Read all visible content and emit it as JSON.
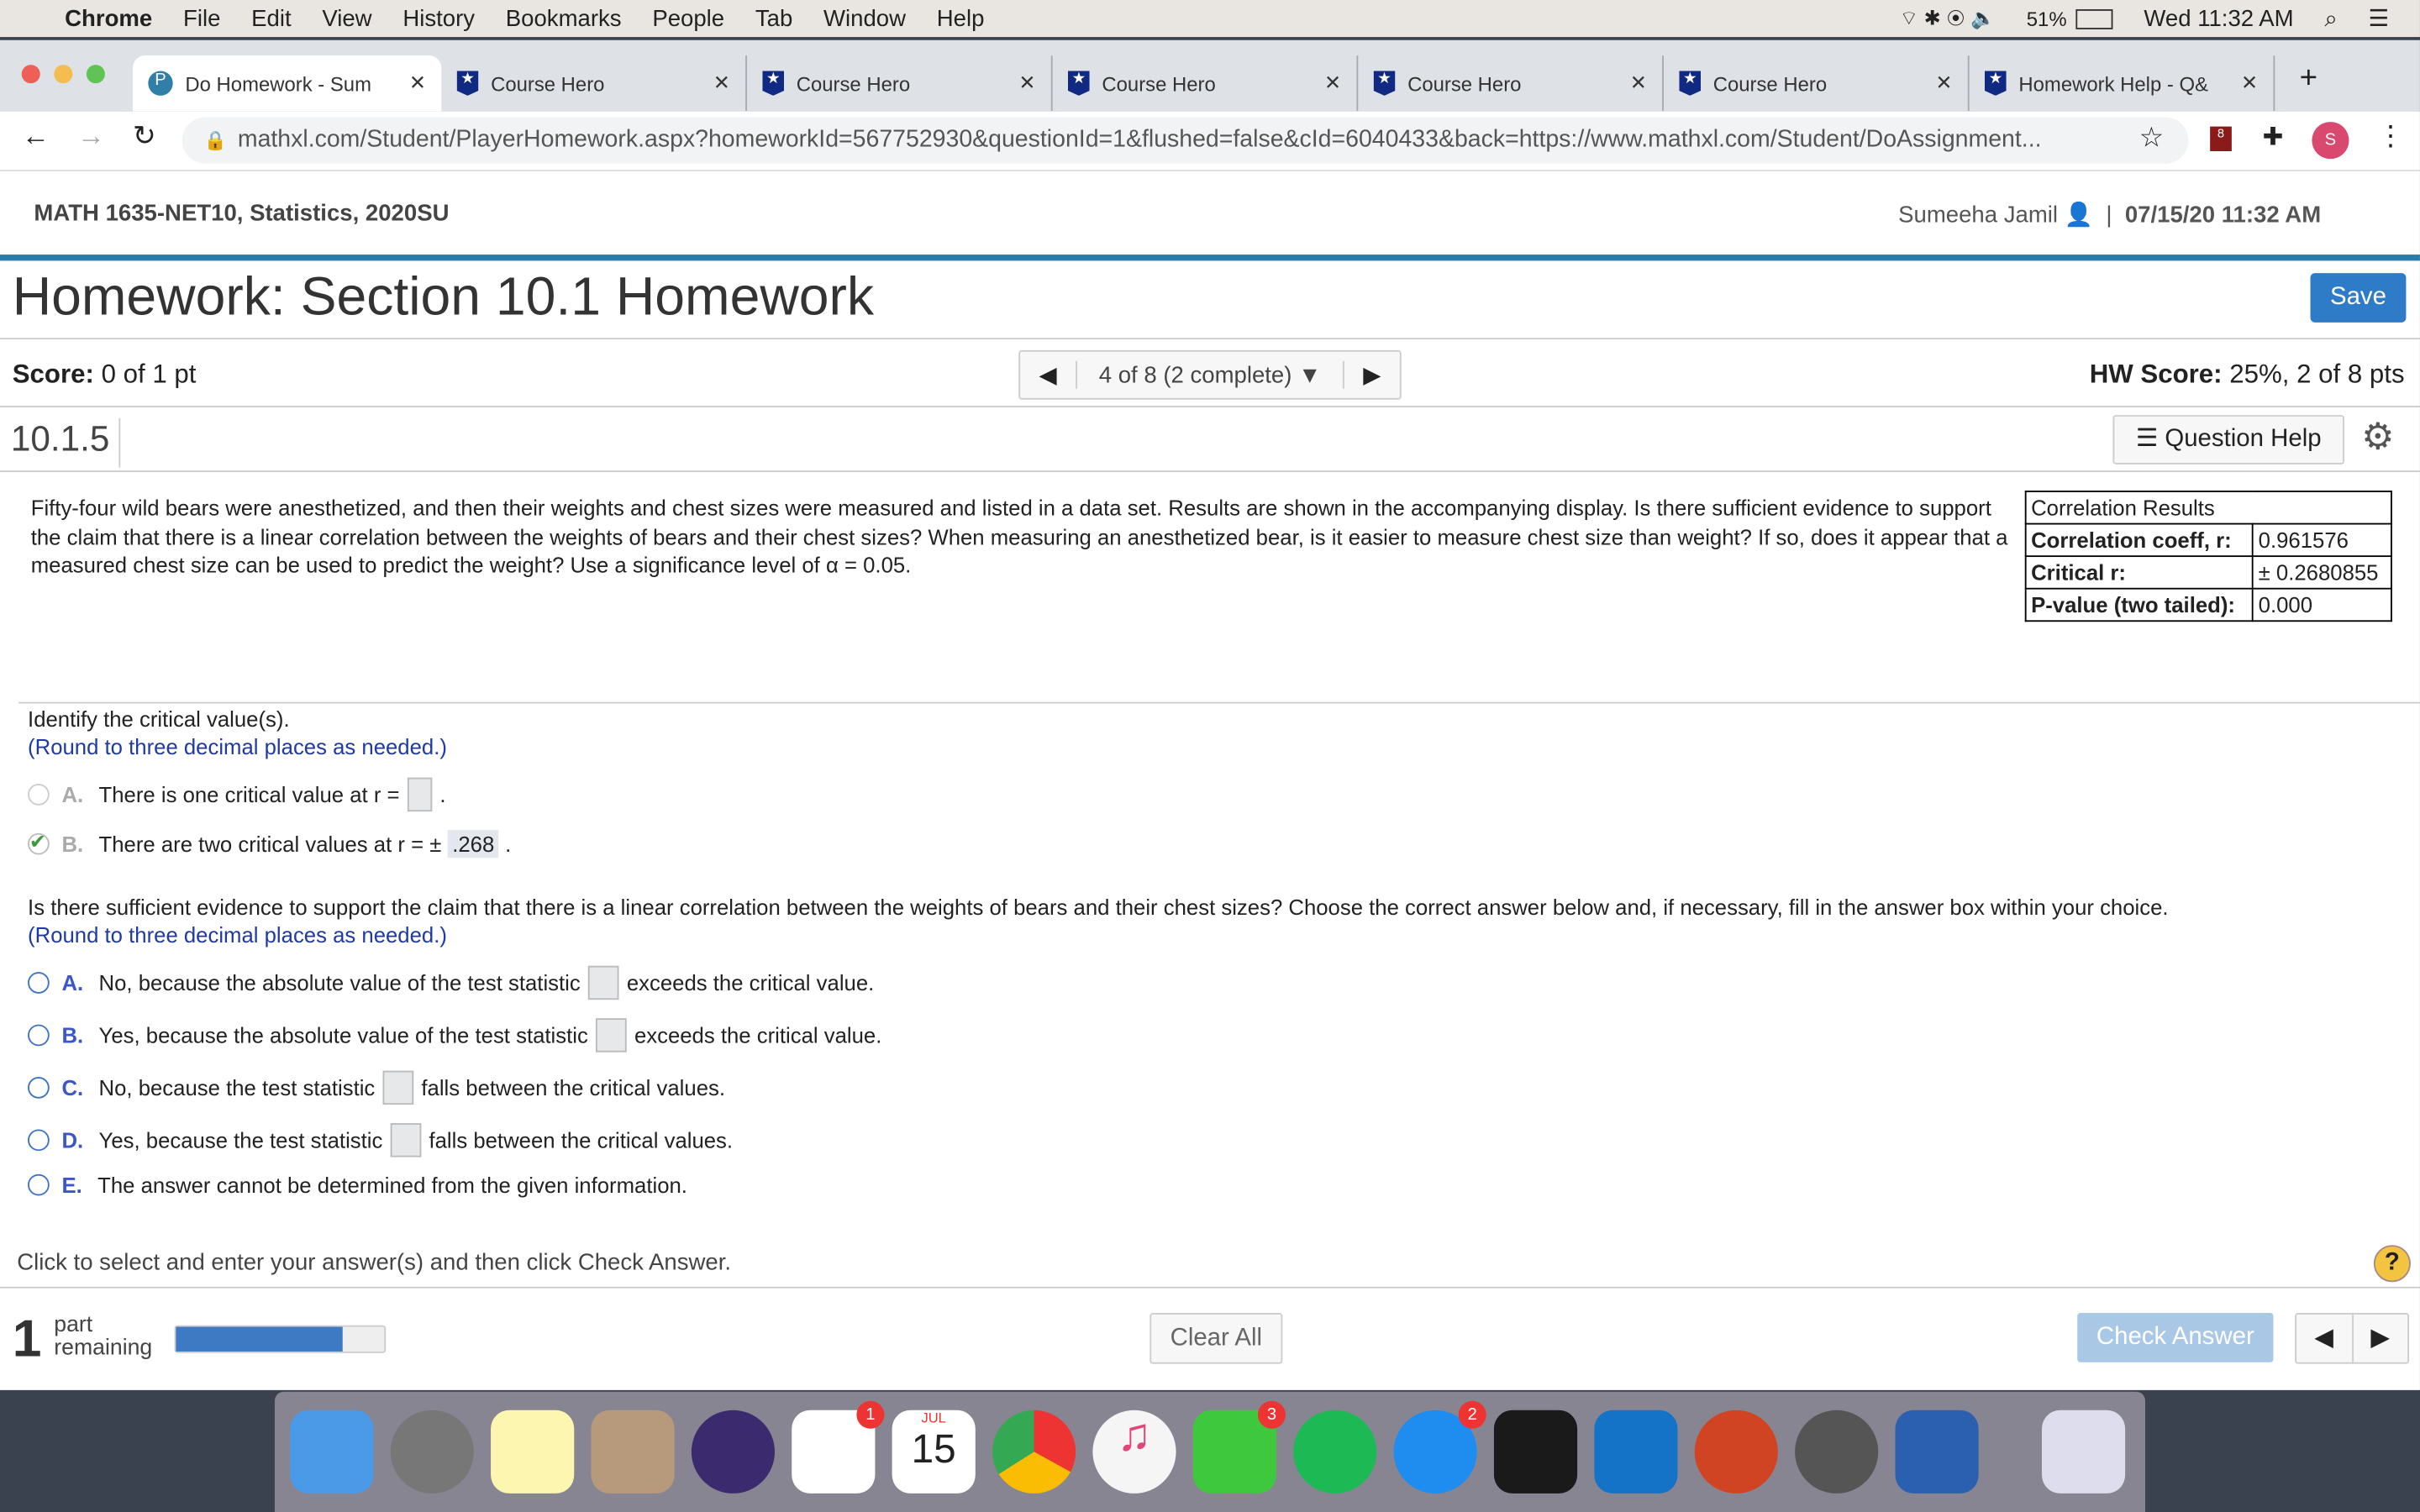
{
  "menubar": {
    "items": [
      "Chrome",
      "File",
      "Edit",
      "View",
      "History",
      "Bookmarks",
      "People",
      "Tab",
      "Window",
      "Help"
    ],
    "battery": "51%",
    "clock": "Wed 11:32 AM"
  },
  "tabs": [
    {
      "label": "Do Homework - Sum",
      "icon": "pearson-icon"
    },
    {
      "label": "Course Hero",
      "icon": "course-hero-icon"
    },
    {
      "label": "Course Hero",
      "icon": "course-hero-icon"
    },
    {
      "label": "Course Hero",
      "icon": "course-hero-icon"
    },
    {
      "label": "Course Hero",
      "icon": "course-hero-icon"
    },
    {
      "label": "Course Hero",
      "icon": "course-hero-icon"
    },
    {
      "label": "Homework Help - Q&",
      "icon": "course-hero-icon"
    }
  ],
  "url": "mathxl.com/Student/PlayerHomework.aspx?homeworkId=567752930&questionId=1&flushed=false&cId=6040433&back=https://www.mathxl.com/Student/DoAssignment...",
  "profile_initial": "S",
  "extension_badge": "8",
  "course": {
    "title": "MATH 1635-NET10, Statistics, 2020SU",
    "user": "Sumeeha Jamil",
    "datetime": "07/15/20 11:32 AM"
  },
  "homework": {
    "title": "Homework: Section 10.1 Homework",
    "save": "Save",
    "score_label": "Score:",
    "score": "0 of 1 pt",
    "nav": "4 of 8 (2 complete)",
    "hw_score_label": "HW Score:",
    "hw_score": "25%, 2 of 8 pts"
  },
  "question": {
    "number": "10.1.5",
    "help": "Question Help",
    "text": "Fifty-four wild bears were anesthetized, and then their weights and chest sizes were measured and listed in a data set. Results are shown in the accompanying display. Is there sufficient evidence to support the claim that there is a linear correlation between the weights of bears and their chest sizes? When measuring an anesthetized bear, is it easier to measure chest size than weight? If so, does it appear that a measured chest size can be used to predict the weight? Use a significance level of α = 0.05.",
    "table": {
      "title": "Correlation Results",
      "rows": [
        [
          "Correlation coeff, r:",
          "0.961576"
        ],
        [
          "Critical r:",
          "± 0.2680855"
        ],
        [
          "P-value (two tailed):",
          "0.000"
        ]
      ]
    },
    "part1": {
      "prompt": "Identify the critical value(s).",
      "hint": "(Round to three decimal places as needed.)",
      "A": {
        "letter": "A.",
        "pre": "There is one critical value at r =",
        "post": "."
      },
      "B": {
        "letter": "B.",
        "pre": "There are two critical values at r = ±",
        "value": ".268",
        "post": ".",
        "selected": true
      }
    },
    "part2": {
      "prompt": "Is there sufficient evidence to support the claim that there is a linear correlation between the weights of bears and their chest sizes? Choose the correct answer below and, if necessary, fill in the answer box within your choice.",
      "hint": "(Round to three decimal places as needed.)",
      "options": [
        {
          "letter": "A.",
          "pre": "No, because the absolute value of the test statistic",
          "post": "exceeds the critical value."
        },
        {
          "letter": "B.",
          "pre": "Yes, because the absolute value of the test statistic",
          "post": "exceeds the critical value."
        },
        {
          "letter": "C.",
          "pre": "No, because the test statistic",
          "post": "falls between the critical values."
        },
        {
          "letter": "D.",
          "pre": "Yes, because the test statistic",
          "post": "falls between the critical values."
        },
        {
          "letter": "E.",
          "pre": "The answer cannot be determined from the given information.",
          "post": ""
        }
      ]
    }
  },
  "footer": {
    "instruction": "Click to select and enter your answer(s) and then click Check Answer.",
    "parts_count": "1",
    "parts_label1": "part",
    "parts_label2": "remaining",
    "progress": 0.8,
    "clear": "Clear All",
    "check": "Check Answer"
  },
  "dock": {
    "badges": {
      "reminders": "1",
      "facetime": "3",
      "appstore": "2"
    },
    "calendar_month": "JUL",
    "calendar_day": "15"
  }
}
